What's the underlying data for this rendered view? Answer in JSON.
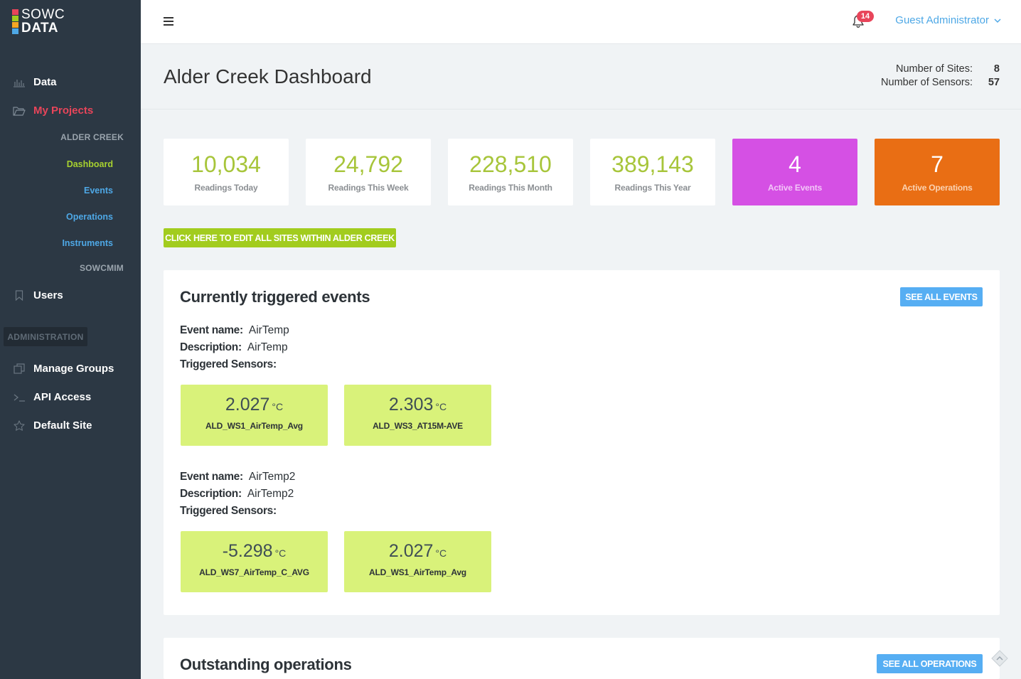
{
  "logo": {
    "line1": "SOWC",
    "line2": "DATA",
    "colors": [
      "#e8455a",
      "#a2cc1e",
      "#f5a623",
      "#4ea8e6"
    ]
  },
  "sidebar": {
    "items": [
      {
        "label": "Data",
        "icon": "bar-chart-icon"
      },
      {
        "label": "My Projects",
        "icon": "folder-open-icon"
      },
      {
        "label": "Users",
        "icon": "bookmark-icon"
      },
      {
        "label": "Manage Groups",
        "icon": "copy-icon"
      },
      {
        "label": "API Access",
        "icon": "terminal-icon"
      },
      {
        "label": "Default Site",
        "icon": "star-icon"
      }
    ],
    "project_name": "ALDER CREEK",
    "sub_items": [
      {
        "label": "Dashboard"
      },
      {
        "label": "Events"
      },
      {
        "label": "Operations"
      },
      {
        "label": "Instruments"
      }
    ],
    "other_project": "SOWCMIM",
    "admin_label": "ADMINISTRATION"
  },
  "topbar": {
    "notification_count": "14",
    "user_name": "Guest Administrator"
  },
  "header": {
    "title": "Alder Creek Dashboard",
    "sites_label": "Number of Sites:",
    "sites_value": "8",
    "sensors_label": "Number of Sensors:",
    "sensors_value": "57"
  },
  "stats": [
    {
      "value": "10,034",
      "label": "Readings Today"
    },
    {
      "value": "24,792",
      "label": "Readings This Week"
    },
    {
      "value": "228,510",
      "label": "Readings This Month"
    },
    {
      "value": "389,143",
      "label": "Readings This Year"
    },
    {
      "value": "4",
      "label": "Active Events",
      "color": "#d550e4"
    },
    {
      "value": "7",
      "label": "Active Operations",
      "color": "#e96e14"
    }
  ],
  "edit_button": "CLICK HERE TO EDIT ALL SITES WITHIN ALDER CREEK",
  "events_panel": {
    "title": "Currently triggered events",
    "button": "SEE ALL EVENTS",
    "labels": {
      "name": "Event name:",
      "description": "Description:",
      "sensors": "Triggered Sensors:"
    },
    "events": [
      {
        "name": "AirTemp",
        "description": "AirTemp",
        "sensors": [
          {
            "value": "2.027",
            "unit": "°C",
            "name": "ALD_WS1_AirTemp_Avg"
          },
          {
            "value": "2.303",
            "unit": "°C",
            "name": "ALD_WS3_AT15M-AVE"
          }
        ]
      },
      {
        "name": "AirTemp2",
        "description": "AirTemp2",
        "sensors": [
          {
            "value": "-5.298",
            "unit": "°C",
            "name": "ALD_WS7_AirTemp_C_AVG"
          },
          {
            "value": "2.027",
            "unit": "°C",
            "name": "ALD_WS1_AirTemp_Avg"
          }
        ]
      }
    ]
  },
  "operations_panel": {
    "title": "Outstanding operations",
    "button": "SEE ALL OPERATIONS"
  }
}
